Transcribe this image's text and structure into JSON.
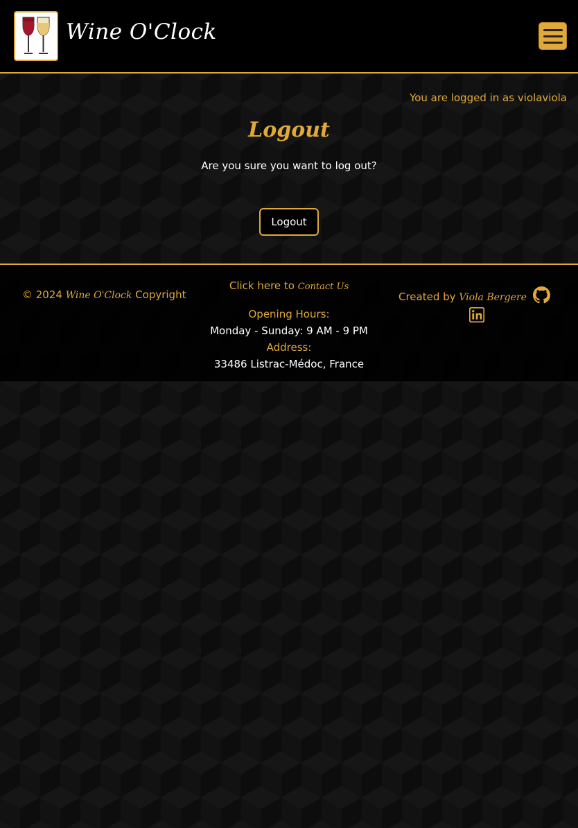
{
  "header": {
    "brand": "Wine O'Clock",
    "logo_icon": "wine-glasses-logo",
    "menu_icon": "hamburger-icon"
  },
  "main": {
    "login_status": "You are logged in as violaviola",
    "title": "Logout",
    "confirm_text": "Are you sure you want to log out?",
    "logout_button": "Logout"
  },
  "footer": {
    "copyright_prefix": "© 2024",
    "copyright_brand": "Wine O'Clock",
    "copyright_suffix": "Copyright",
    "contact_prefix": "Click here to",
    "contact_link": "Contact Us",
    "hours_label": "Opening Hours:",
    "hours_value": "Monday - Sunday: 9 AM - 9 PM",
    "address_label": "Address:",
    "address_value": "33486 Listrac-Médoc, France",
    "created_prefix": "Created by",
    "created_name": "Viola Bergere",
    "github_icon": "github-icon",
    "linkedin_icon": "linkedin-icon"
  },
  "colors": {
    "accent": "#e0a93a",
    "background": "#0d0d0d",
    "text": "#ffffff"
  }
}
